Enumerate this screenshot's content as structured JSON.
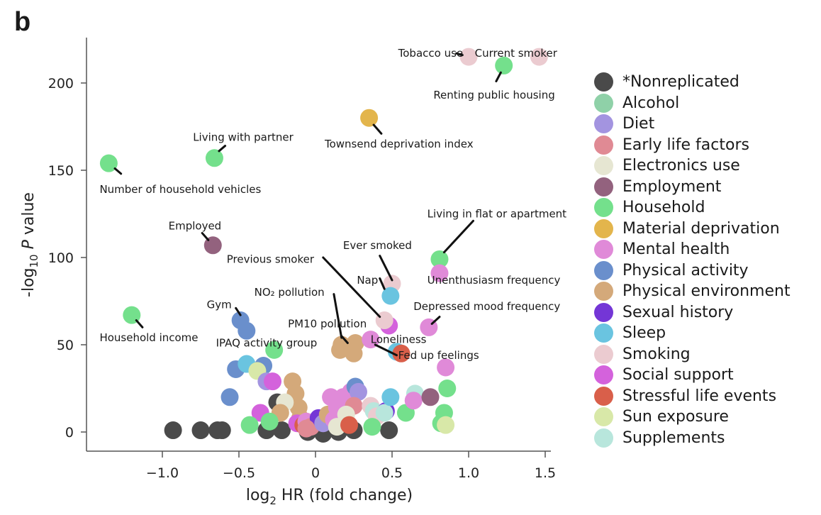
{
  "panel_label": "b",
  "chart_data": {
    "type": "scatter",
    "title": "",
    "xlabel": "log2 HR (fold change)",
    "xlabel_parts": {
      "pre": "log",
      "sub": "2",
      "post": " HR (fold change)"
    },
    "ylabel": "-log10 P value",
    "ylabel_parts": {
      "pre": "-log",
      "sub": "10",
      "italic": "P",
      "post": " value"
    },
    "xlim": [
      -1.45,
      1.6
    ],
    "ylim": [
      -11,
      226
    ],
    "xticks": [
      -1.0,
      -0.5,
      0,
      0.5,
      1.0,
      1.5
    ],
    "xtick_labels": [
      "−1.0",
      "−0.5",
      "0",
      "0.5",
      "1.0",
      "1.5"
    ],
    "yticks": [
      0,
      50,
      100,
      150,
      200
    ],
    "ytick_labels": [
      "0",
      "50",
      "100",
      "150",
      "200"
    ],
    "grid": false,
    "legend_position": "right",
    "categories": [
      {
        "name": "*Nonreplicated",
        "color": "#4a4a4a"
      },
      {
        "name": "Alcohol",
        "color": "#8fd1a8"
      },
      {
        "name": "Diet",
        "color": "#a394e0"
      },
      {
        "name": "Early life factors",
        "color": "#e08a94"
      },
      {
        "name": "Electronics use",
        "color": "#e6e6d2"
      },
      {
        "name": "Employment",
        "color": "#93627e"
      },
      {
        "name": "Household",
        "color": "#74e08c"
      },
      {
        "name": "Material deprivation",
        "color": "#e3b54c"
      },
      {
        "name": "Mental health",
        "color": "#e08ad8"
      },
      {
        "name": "Physical activity",
        "color": "#6a8fcc"
      },
      {
        "name": "Physical environment",
        "color": "#d4a97a"
      },
      {
        "name": "Sexual history",
        "color": "#7436d6"
      },
      {
        "name": "Sleep",
        "color": "#6ac4e0"
      },
      {
        "name": "Smoking",
        "color": "#ebcbd0"
      },
      {
        "name": "Social support",
        "color": "#d462dc"
      },
      {
        "name": "Stressful life events",
        "color": "#d95f4a"
      },
      {
        "name": "Sun exposure",
        "color": "#d8e8a8"
      },
      {
        "name": "Supplements",
        "color": "#b8e6dc"
      }
    ],
    "points": [
      {
        "x": 1.0,
        "y": 215,
        "cat": "Smoking",
        "label": "Tobacco use"
      },
      {
        "x": 1.46,
        "y": 215,
        "cat": "Smoking",
        "label": "Current smoker"
      },
      {
        "x": 1.23,
        "y": 210,
        "cat": "Household",
        "label": "Renting public housing"
      },
      {
        "x": 0.35,
        "y": 180,
        "cat": "Material deprivation",
        "label": "Townsend deprivation index"
      },
      {
        "x": -0.66,
        "y": 157,
        "cat": "Household",
        "label": "Living with partner"
      },
      {
        "x": -1.35,
        "y": 154,
        "cat": "Household",
        "label": "Number of household vehicles"
      },
      {
        "x": -0.67,
        "y": 107,
        "cat": "Employment",
        "label": "Employed"
      },
      {
        "x": 0.81,
        "y": 99,
        "cat": "Household",
        "label": "Living in flat or apartment"
      },
      {
        "x": 0.81,
        "y": 91,
        "cat": "Mental health",
        "label": "Unenthusiasm frequency"
      },
      {
        "x": 0.5,
        "y": 85,
        "cat": "Smoking",
        "label": "Ever smoked"
      },
      {
        "x": 0.49,
        "y": 78,
        "cat": "Sleep",
        "label": "Nap"
      },
      {
        "x": -1.2,
        "y": 67,
        "cat": "Household",
        "label": "Household income"
      },
      {
        "x": -0.49,
        "y": 64,
        "cat": "Physical activity",
        "label": "Gym"
      },
      {
        "x": -0.45,
        "y": 58,
        "cat": "Physical activity",
        "label": "IPAQ activity group"
      },
      {
        "x": 0.48,
        "y": 61,
        "cat": "Social support",
        "label": null
      },
      {
        "x": 0.45,
        "y": 64,
        "cat": "Smoking",
        "label": "Previous smoker"
      },
      {
        "x": 0.74,
        "y": 60,
        "cat": "Mental health",
        "label": "Depressed mood frequency"
      },
      {
        "x": 0.17,
        "y": 50,
        "cat": "Physical environment",
        "label": "NO2 pollution"
      },
      {
        "x": 0.22,
        "y": 48,
        "cat": "Physical environment",
        "label": "PM10 pollution"
      },
      {
        "x": 0.26,
        "y": 51,
        "cat": "Physical environment",
        "label": null
      },
      {
        "x": 0.16,
        "y": 47,
        "cat": "Physical environment",
        "label": null
      },
      {
        "x": 0.25,
        "y": 45,
        "cat": "Physical environment",
        "label": null
      },
      {
        "x": 0.36,
        "y": 53,
        "cat": "Mental health",
        "label": "Loneliness"
      },
      {
        "x": 0.53,
        "y": 46,
        "cat": "Sleep",
        "label": null
      },
      {
        "x": 0.56,
        "y": 45,
        "cat": "Stressful life events",
        "label": "Fed up feelings"
      },
      {
        "x": -0.27,
        "y": 47,
        "cat": "Household",
        "label": null
      },
      {
        "x": -0.52,
        "y": 36,
        "cat": "Physical activity",
        "label": null
      },
      {
        "x": -0.45,
        "y": 39,
        "cat": "Sleep",
        "label": null
      },
      {
        "x": -0.34,
        "y": 38,
        "cat": "Physical activity",
        "label": null
      },
      {
        "x": -0.38,
        "y": 35,
        "cat": "Sun exposure",
        "label": null
      },
      {
        "x": -0.32,
        "y": 29,
        "cat": "Diet",
        "label": null
      },
      {
        "x": -0.28,
        "y": 29,
        "cat": "Social support",
        "label": null
      },
      {
        "x": -0.56,
        "y": 20,
        "cat": "Physical activity",
        "label": null
      },
      {
        "x": -0.15,
        "y": 29,
        "cat": "Physical environment",
        "label": null
      },
      {
        "x": -0.13,
        "y": 22,
        "cat": "Physical environment",
        "label": null
      },
      {
        "x": -0.11,
        "y": 14,
        "cat": "Physical environment",
        "label": null
      },
      {
        "x": -0.1,
        "y": 8,
        "cat": "Physical environment",
        "label": null
      },
      {
        "x": -0.25,
        "y": 17,
        "cat": "*Nonreplicated",
        "label": null
      },
      {
        "x": -0.2,
        "y": 17,
        "cat": "Electronics use",
        "label": null
      },
      {
        "x": -0.23,
        "y": 11,
        "cat": "Physical environment",
        "label": null
      },
      {
        "x": -0.36,
        "y": 11,
        "cat": "Social support",
        "label": null
      },
      {
        "x": -0.3,
        "y": 6,
        "cat": "Household",
        "label": null
      },
      {
        "x": -0.43,
        "y": 4,
        "cat": "Household",
        "label": null
      },
      {
        "x": -0.93,
        "y": 1,
        "cat": "*Nonreplicated",
        "label": null
      },
      {
        "x": -0.75,
        "y": 1,
        "cat": "*Nonreplicated",
        "label": null
      },
      {
        "x": -0.64,
        "y": 1,
        "cat": "*Nonreplicated",
        "label": null
      },
      {
        "x": -0.61,
        "y": 1,
        "cat": "*Nonreplicated",
        "label": null
      },
      {
        "x": -0.32,
        "y": 1,
        "cat": "*Nonreplicated",
        "label": null
      },
      {
        "x": -0.22,
        "y": 1,
        "cat": "*Nonreplicated",
        "label": null
      },
      {
        "x": -0.05,
        "y": 0,
        "cat": "*Nonreplicated",
        "label": null
      },
      {
        "x": 0.05,
        "y": -1,
        "cat": "*Nonreplicated",
        "label": null
      },
      {
        "x": 0.15,
        "y": 0,
        "cat": "*Nonreplicated",
        "label": null
      },
      {
        "x": 0.25,
        "y": 1,
        "cat": "*Nonreplicated",
        "label": null
      },
      {
        "x": 0.48,
        "y": 1,
        "cat": "*Nonreplicated",
        "label": null
      },
      {
        "x": -0.12,
        "y": 5,
        "cat": "Social support",
        "label": null
      },
      {
        "x": -0.08,
        "y": 4,
        "cat": "Stressful life events",
        "label": null
      },
      {
        "x": -0.06,
        "y": 6,
        "cat": "Mental health",
        "label": null
      },
      {
        "x": -0.03,
        "y": 3,
        "cat": "Early life factors",
        "label": null
      },
      {
        "x": 0.02,
        "y": 8,
        "cat": "Sexual history",
        "label": null
      },
      {
        "x": 0.05,
        "y": 5,
        "cat": "Diet",
        "label": null
      },
      {
        "x": 0.08,
        "y": 10,
        "cat": "Physical environment",
        "label": null
      },
      {
        "x": 0.1,
        "y": 20,
        "cat": "Mental health",
        "label": null
      },
      {
        "x": 0.14,
        "y": 14,
        "cat": "Mental health",
        "label": null
      },
      {
        "x": 0.18,
        "y": 20,
        "cat": "Mental health",
        "label": null
      },
      {
        "x": 0.23,
        "y": 23,
        "cat": "Mental health",
        "label": null
      },
      {
        "x": 0.26,
        "y": 26,
        "cat": "Physical activity",
        "label": null
      },
      {
        "x": 0.28,
        "y": 23,
        "cat": "Diet",
        "label": null
      },
      {
        "x": 0.25,
        "y": 15,
        "cat": "Early life factors",
        "label": null
      },
      {
        "x": 0.12,
        "y": 7,
        "cat": "Mental health",
        "label": null
      },
      {
        "x": 0.2,
        "y": 10,
        "cat": "Electronics use",
        "label": null
      },
      {
        "x": 0.14,
        "y": 3,
        "cat": "Electronics use",
        "label": null
      },
      {
        "x": 0.22,
        "y": 4,
        "cat": "Stressful life events",
        "label": null
      },
      {
        "x": 0.36,
        "y": 15,
        "cat": "Smoking",
        "label": null
      },
      {
        "x": 0.38,
        "y": 12,
        "cat": "Supplements",
        "label": null
      },
      {
        "x": 0.4,
        "y": 9,
        "cat": "Smoking",
        "label": null
      },
      {
        "x": 0.46,
        "y": 12,
        "cat": "Sexual history",
        "label": null
      },
      {
        "x": 0.45,
        "y": 11,
        "cat": "Supplements",
        "label": null
      },
      {
        "x": 0.49,
        "y": 20,
        "cat": "Sleep",
        "label": null
      },
      {
        "x": 0.37,
        "y": 3,
        "cat": "Household",
        "label": null
      },
      {
        "x": 0.59,
        "y": 11,
        "cat": "Household",
        "label": null
      },
      {
        "x": 0.65,
        "y": 22,
        "cat": "Supplements",
        "label": null
      },
      {
        "x": 0.64,
        "y": 18,
        "cat": "Mental health",
        "label": null
      },
      {
        "x": 0.75,
        "y": 20,
        "cat": "Employment",
        "label": null
      },
      {
        "x": 0.85,
        "y": 37,
        "cat": "Mental health",
        "label": null
      },
      {
        "x": 0.86,
        "y": 25,
        "cat": "Household",
        "label": null
      },
      {
        "x": 0.84,
        "y": 11,
        "cat": "Household",
        "label": null
      },
      {
        "x": 0.82,
        "y": 5,
        "cat": "Household",
        "label": null
      },
      {
        "x": 0.85,
        "y": 4,
        "cat": "Sun exposure",
        "label": null
      },
      {
        "x": -0.06,
        "y": 2,
        "cat": "Early life factors",
        "label": null
      }
    ],
    "annotations": [
      {
        "text": "Tobacco use",
        "tx": 0.54,
        "ty": 217,
        "anchor": "start",
        "lx1": 0.92,
        "ly1": 217,
        "lx2": 0.96,
        "ly2": 216
      },
      {
        "text": "Current smoker",
        "tx": 1.04,
        "ty": 217,
        "anchor": "start",
        "lx1": null
      },
      {
        "text": "Renting public housing",
        "tx": 0.77,
        "ty": 193,
        "anchor": "start",
        "lx1": 1.18,
        "ly1": 201,
        "lx2": 1.21,
        "ly2": 206
      },
      {
        "text": "Townsend deprivation index",
        "tx": 0.06,
        "ty": 165,
        "anchor": "start",
        "lx1": 0.38,
        "ly1": 176,
        "lx2": 0.43,
        "ly2": 171
      },
      {
        "text": "Living with partner",
        "tx": -0.8,
        "ty": 169,
        "anchor": "start",
        "lx1": -0.63,
        "ly1": 161,
        "lx2": -0.59,
        "ly2": 164
      },
      {
        "text": "Number of household vehicles",
        "tx": -1.41,
        "ty": 139,
        "anchor": "start",
        "lx1": -1.31,
        "ly1": 151,
        "lx2": -1.27,
        "ly2": 148
      },
      {
        "text": "Employed",
        "tx": -0.96,
        "ty": 118,
        "anchor": "start",
        "lx1": -0.74,
        "ly1": 114,
        "lx2": -0.7,
        "ly2": 110
      },
      {
        "text": "Living in flat or apartment",
        "tx": 0.73,
        "ty": 125,
        "anchor": "start",
        "lx1": 0.84,
        "ly1": 103,
        "lx2": 1.03,
        "ly2": 121
      },
      {
        "text": "Unenthusiasm frequency",
        "tx": 0.73,
        "ty": 87,
        "anchor": "start",
        "lx1": null
      },
      {
        "text": "Ever smoked",
        "tx": 0.18,
        "ty": 107,
        "anchor": "start",
        "lx1": 0.42,
        "ly1": 101,
        "lx2": 0.5,
        "ly2": 87
      },
      {
        "text": "Nap",
        "tx": 0.27,
        "ty": 87,
        "anchor": "start",
        "lx1": 0.42,
        "ly1": 88,
        "lx2": 0.45,
        "ly2": 82
      },
      {
        "text": "Previous smoker",
        "tx": -0.58,
        "ty": 99,
        "anchor": "start",
        "lx1": 0.05,
        "ly1": 100,
        "lx2": 0.42,
        "ly2": 66
      },
      {
        "text": "NO₂ pollution",
        "tx": -0.4,
        "ty": 80,
        "anchor": "start",
        "lx1": 0.12,
        "ly1": 79,
        "lx2": 0.17,
        "ly2": 54
      },
      {
        "text": "Gym",
        "tx": -0.71,
        "ty": 73,
        "anchor": "start",
        "lx1": -0.52,
        "ly1": 71,
        "lx2": -0.49,
        "ly2": 67
      },
      {
        "text": "PM10 pollution",
        "tx": -0.18,
        "ty": 62,
        "anchor": "start",
        "lx1": 0.17,
        "ly1": 55,
        "lx2": 0.21,
        "ly2": 51
      },
      {
        "text": "Depressed mood frequency",
        "tx": 0.64,
        "ty": 72,
        "anchor": "start",
        "lx1": 0.76,
        "ly1": 62,
        "lx2": 0.81,
        "ly2": 66
      },
      {
        "text": "IPAQ activity group",
        "tx": -0.65,
        "ty": 51,
        "anchor": "start",
        "lx1": null
      },
      {
        "text": "Household income",
        "tx": -1.41,
        "ty": 54,
        "anchor": "start",
        "lx1": -1.17,
        "ly1": 64,
        "lx2": -1.13,
        "ly2": 60
      },
      {
        "text": "Loneliness",
        "tx": 0.36,
        "ty": 53,
        "anchor": "start",
        "lx1": null
      },
      {
        "text": "Fed up feelings",
        "tx": 0.54,
        "ty": 44,
        "anchor": "start",
        "lx1": 0.39,
        "ly1": 50,
        "lx2": 0.53,
        "ly2": 44
      }
    ]
  }
}
